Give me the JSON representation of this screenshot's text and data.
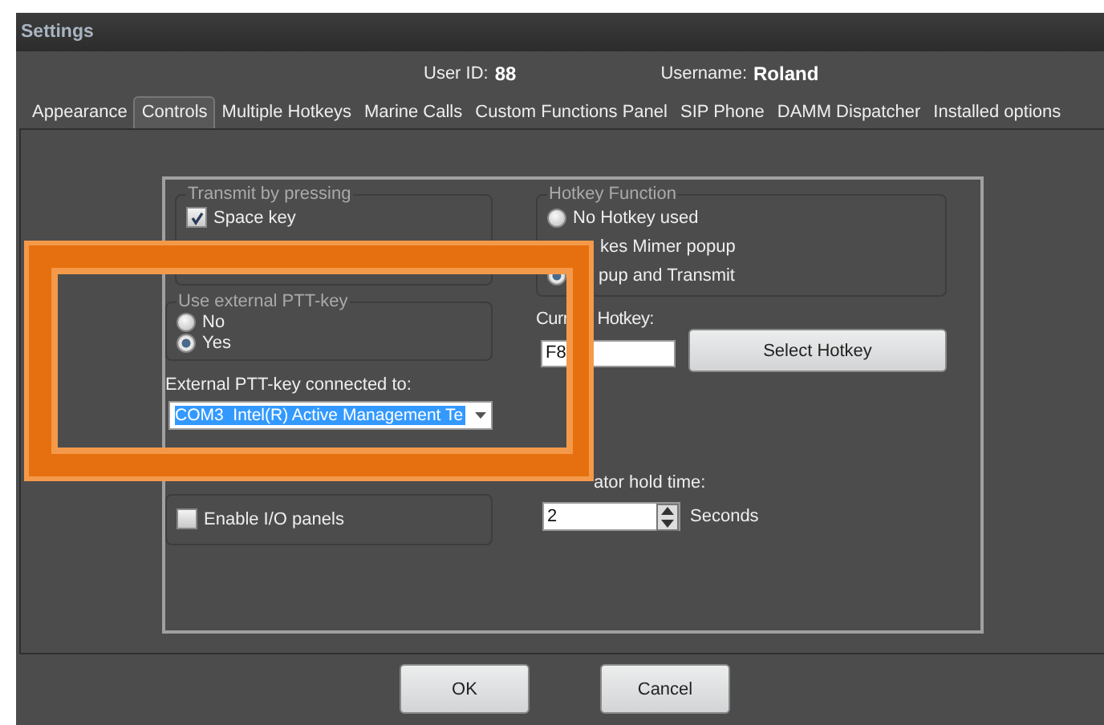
{
  "window": {
    "title": "Settings"
  },
  "header": {
    "user_id_label": "User ID:",
    "user_id": "88",
    "username_label": "Username:",
    "username": "Roland"
  },
  "tabs": [
    {
      "label": "Appearance",
      "selected": false
    },
    {
      "label": "Controls",
      "selected": true
    },
    {
      "label": "Multiple Hotkeys",
      "selected": false
    },
    {
      "label": "Marine Calls",
      "selected": false
    },
    {
      "label": "Custom Functions Panel",
      "selected": false
    },
    {
      "label": "SIP Phone",
      "selected": false
    },
    {
      "label": "DAMM Dispatcher",
      "selected": false
    },
    {
      "label": "Installed options",
      "selected": false
    }
  ],
  "transmit_group": {
    "title": "Transmit by pressing",
    "checkbox": {
      "label": "Space key",
      "checked": true
    }
  },
  "ptt_group": {
    "title": "Use external PTT-key",
    "options": [
      {
        "label": "No",
        "selected": false
      },
      {
        "label": "Yes",
        "selected": true
      }
    ]
  },
  "ptt_port": {
    "label": "External PTT-key connected to:",
    "value": "COM3  Intel(R) Active Management Te"
  },
  "io_group": {
    "checkbox": {
      "label": "Enable I/O panels",
      "checked": false
    }
  },
  "hotkey_group": {
    "title": "Hotkey Function",
    "options": [
      {
        "kind": "radio",
        "label": "No Hotkey used",
        "selected": false
      },
      {
        "kind": "cut",
        "label": "kes Mimer popup"
      },
      {
        "kind": "radio_cut",
        "label": "pup and Transmit",
        "selected": true
      }
    ]
  },
  "current_hotkey": {
    "label_parts": [
      "Curr",
      "Hotkey:"
    ],
    "value": "F8",
    "button": "Select Hotkey"
  },
  "hold_time": {
    "label": "ator hold time:",
    "value": "2",
    "unit": "Seconds"
  },
  "buttons": [
    "OK",
    "Cancel"
  ]
}
